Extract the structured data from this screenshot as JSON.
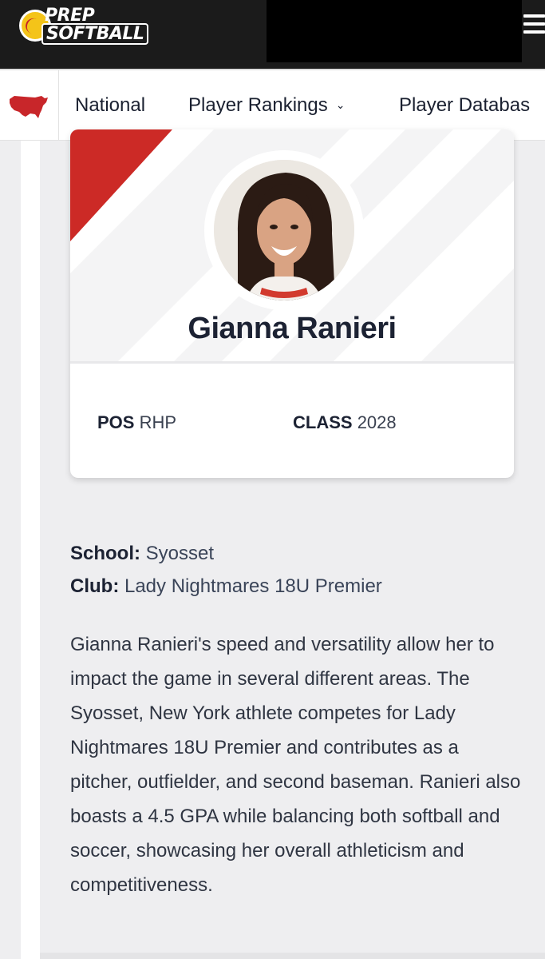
{
  "header": {
    "logo_line1": "PREP",
    "logo_line2": "SOFTBALL",
    "menu_icon": "hamburger-icon"
  },
  "nav": {
    "region_icon": "usa-map-icon",
    "items": [
      {
        "label": "National"
      },
      {
        "label": "Player Rankings",
        "icon": "chevron-down-icon"
      },
      {
        "label": "Player Databas"
      }
    ]
  },
  "player": {
    "name": "Gianna Ranieri",
    "pos_label": "POS",
    "pos_value": "RHP",
    "class_label": "CLASS",
    "class_value": "2028",
    "school_label": "School:",
    "school_value": "Syosset",
    "club_label": "Club:",
    "club_value": "Lady Nightmares 18U Premier",
    "bio": "Gianna Ranieri's speed and versatility allow her to impact the game in several different areas. The Syosset, New York athlete competes for Lady Nightmares 18U Premier and contributes as a pitcher, outfielder, and second baseman. Ranieri also boasts a 4.5 GPA while balancing both softball and soccer, showcasing her overall athleticism and competitiveness."
  },
  "colors": {
    "topbar": "#1b1b1b",
    "accent_red": "#cc2a26",
    "logo_yellow": "#f4c419",
    "text_dark": "#1c2233"
  }
}
